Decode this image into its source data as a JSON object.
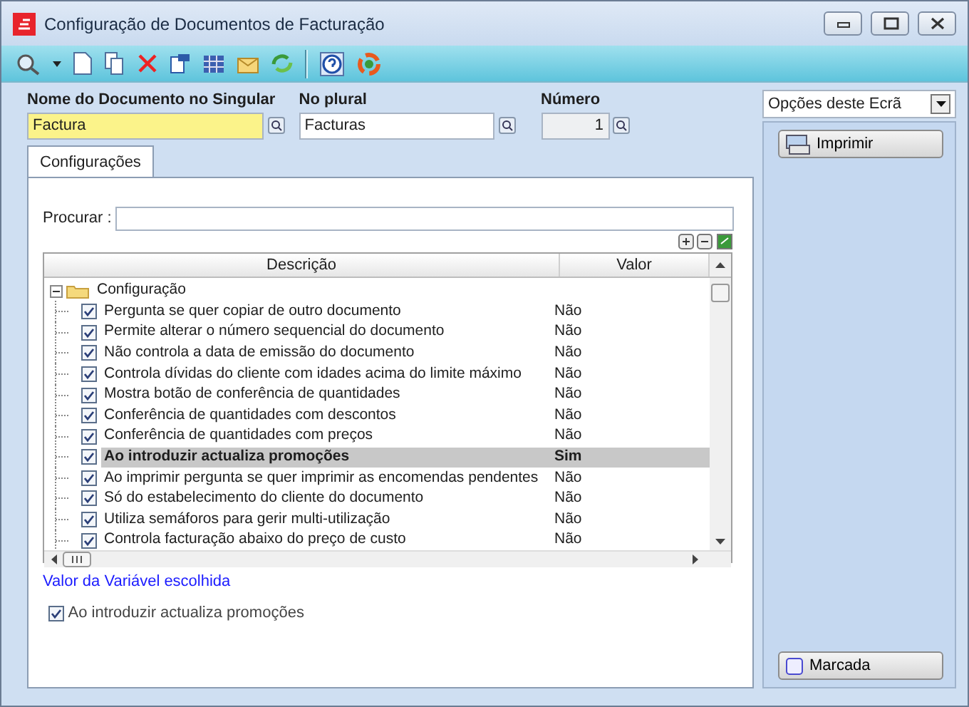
{
  "window": {
    "title": "Configuração de Documentos de Facturação"
  },
  "fields": [
    {
      "kind": "highlight",
      "label": "Nome do Documento no Singular",
      "value": "Factura",
      "disabled": false
    },
    {
      "kind": "text",
      "label": "No plural",
      "value": "Facturas",
      "disabled": false
    },
    {
      "kind": "number",
      "label": "Número",
      "value": "1",
      "disabled": true
    }
  ],
  "tabs": [
    {
      "label": "Configurações",
      "selected": true
    }
  ],
  "search": {
    "label": "Procurar :"
  },
  "table": {
    "columns": [
      "Descrição",
      "Valor"
    ],
    "tree": {
      "label": "Configuração",
      "expanded": true,
      "children": [
        {
          "label": "Pergunta se quer copiar de outro documento",
          "checked": true,
          "value": "Não",
          "selected": false
        },
        {
          "label": "Permite alterar o número sequencial do documento",
          "checked": true,
          "value": "Não",
          "selected": false
        },
        {
          "label": "Não controla a data de emissão do documento",
          "checked": true,
          "value": "Não",
          "selected": false
        },
        {
          "label": "Controla dívidas do cliente com idades acima do limite máximo",
          "checked": true,
          "value": "Não",
          "selected": false
        },
        {
          "label": "Mostra botão de conferência de quantidades",
          "checked": true,
          "value": "Não",
          "selected": false
        },
        {
          "label": "Conferência de quantidades com descontos",
          "checked": true,
          "value": "Não",
          "selected": false
        },
        {
          "label": "Conferência de quantidades com preços",
          "checked": true,
          "value": "Não",
          "selected": false
        },
        {
          "label": "Ao introduzir actualiza promoções",
          "checked": true,
          "value": "Sim",
          "selected": true
        },
        {
          "label": "Ao imprimir pergunta se quer imprimir as encomendas pendentes",
          "checked": true,
          "value": "Não",
          "selected": false
        },
        {
          "label": "Só do estabelecimento do cliente do documento",
          "checked": true,
          "value": "Não",
          "selected": false
        },
        {
          "label": "Utiliza semáforos para gerir multi-utilização",
          "checked": true,
          "value": "Não",
          "selected": false
        },
        {
          "label": "Controla facturação abaixo do preço de custo",
          "checked": true,
          "value": "Não",
          "selected": false
        }
      ]
    }
  },
  "variable": {
    "title": "Valor da Variável escolhida",
    "label": "Ao introduzir actualiza promoções",
    "checked": true
  },
  "side": {
    "dropdown": "Opções deste Ecrã",
    "buttons": [
      {
        "kind": "print",
        "label": "Imprimir"
      },
      {
        "kind": "mark",
        "label": "Marcada"
      }
    ]
  }
}
